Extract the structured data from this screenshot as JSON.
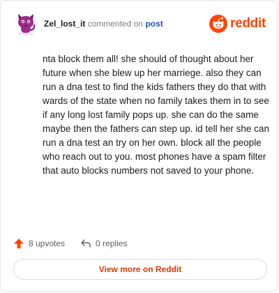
{
  "header": {
    "username": "Zel_lost_it",
    "commented_text": "commented on",
    "post_link": "post",
    "brand": "reddit"
  },
  "comment": {
    "body": "nta block them all! she should of thought about her future when she blew up her marriege. also they can run a dna test to find the kids fathers they do that with wards of the state when no family takes them in to see if any long lost family pops up. she can do the same maybe then the fathers can step up. id tell her she can run a dna test an try on her own. block all the people who reach out to you. most phones have a spam filter that auto blocks numbers not saved to your phone."
  },
  "actions": {
    "upvotes": "8 upvotes",
    "replies": "0 replies"
  },
  "footer": {
    "view_more": "View more on Reddit"
  },
  "colors": {
    "brand": "#ff4500",
    "avatar_bg": "#9c2a8c",
    "link": "#1a57b6"
  }
}
